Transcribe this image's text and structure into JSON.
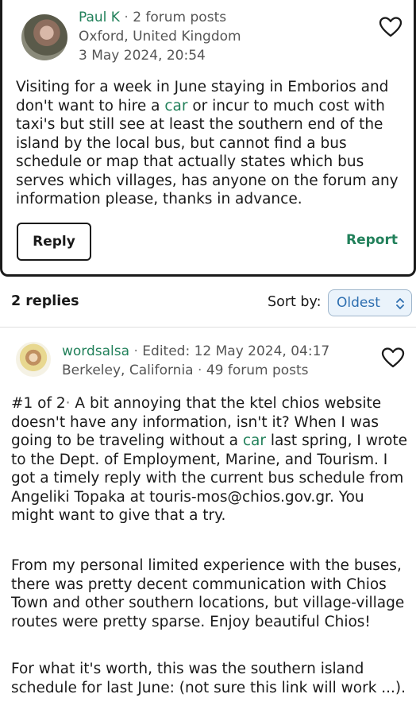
{
  "post": {
    "username": "Paul K",
    "separator": "·",
    "post_count": "2 forum posts",
    "location": "Oxford, United Kingdom",
    "timestamp": "3 May 2024, 20:54",
    "body_before_link": "Visiting for a week in June staying in Emborios and don't want to hire a ",
    "body_link": "car",
    "body_after_link": " or incur to much cost with taxi's but still see at least the southern end of the island by the local bus, but cannot find a bus schedule or map that actually states which bus serves which villages, has anyone on the forum any information please, thanks in advance.",
    "reply_label": "Reply",
    "report_label": "Report"
  },
  "replies_bar": {
    "count_label": "2 replies",
    "sort_label": "Sort by:",
    "sort_value": "Oldest"
  },
  "reply": {
    "username": "wordsalsa",
    "separator": "·",
    "edited": "Edited: 12 May 2024, 04:17",
    "location": "Berkeley, California",
    "post_count": "49 forum posts",
    "index": "#1 of 2",
    "p1_before_link": " A bit annoying that the ktel chios website doesn't have any information, isn't it? When I was going to be traveling without a ",
    "p1_link": "car",
    "p1_after_link": " last spring, I wrote to the Dept. of Employment, Marine, and Tourism. I got a timely reply with the current bus schedule from Angeliki Topaka at touris-mos@chios.gov.gr. You might want to give that a try.",
    "p2": "From my personal limited experience with the buses, there was pretty decent communication with Chios Town and other southern locations, but village-village routes were pretty sparse. Enjoy beautiful Chios!",
    "p3": "For what it's worth, this was the southern island schedule for last June: (not sure this link will work ...)."
  },
  "colors": {
    "accent_green": "#21805a",
    "sort_blue": "#2e6fb0",
    "text": "#1a1a1a",
    "muted": "#555555"
  },
  "icons": {
    "favorite": "heart-outline-icon",
    "sort": "chevron-updown-icon"
  }
}
